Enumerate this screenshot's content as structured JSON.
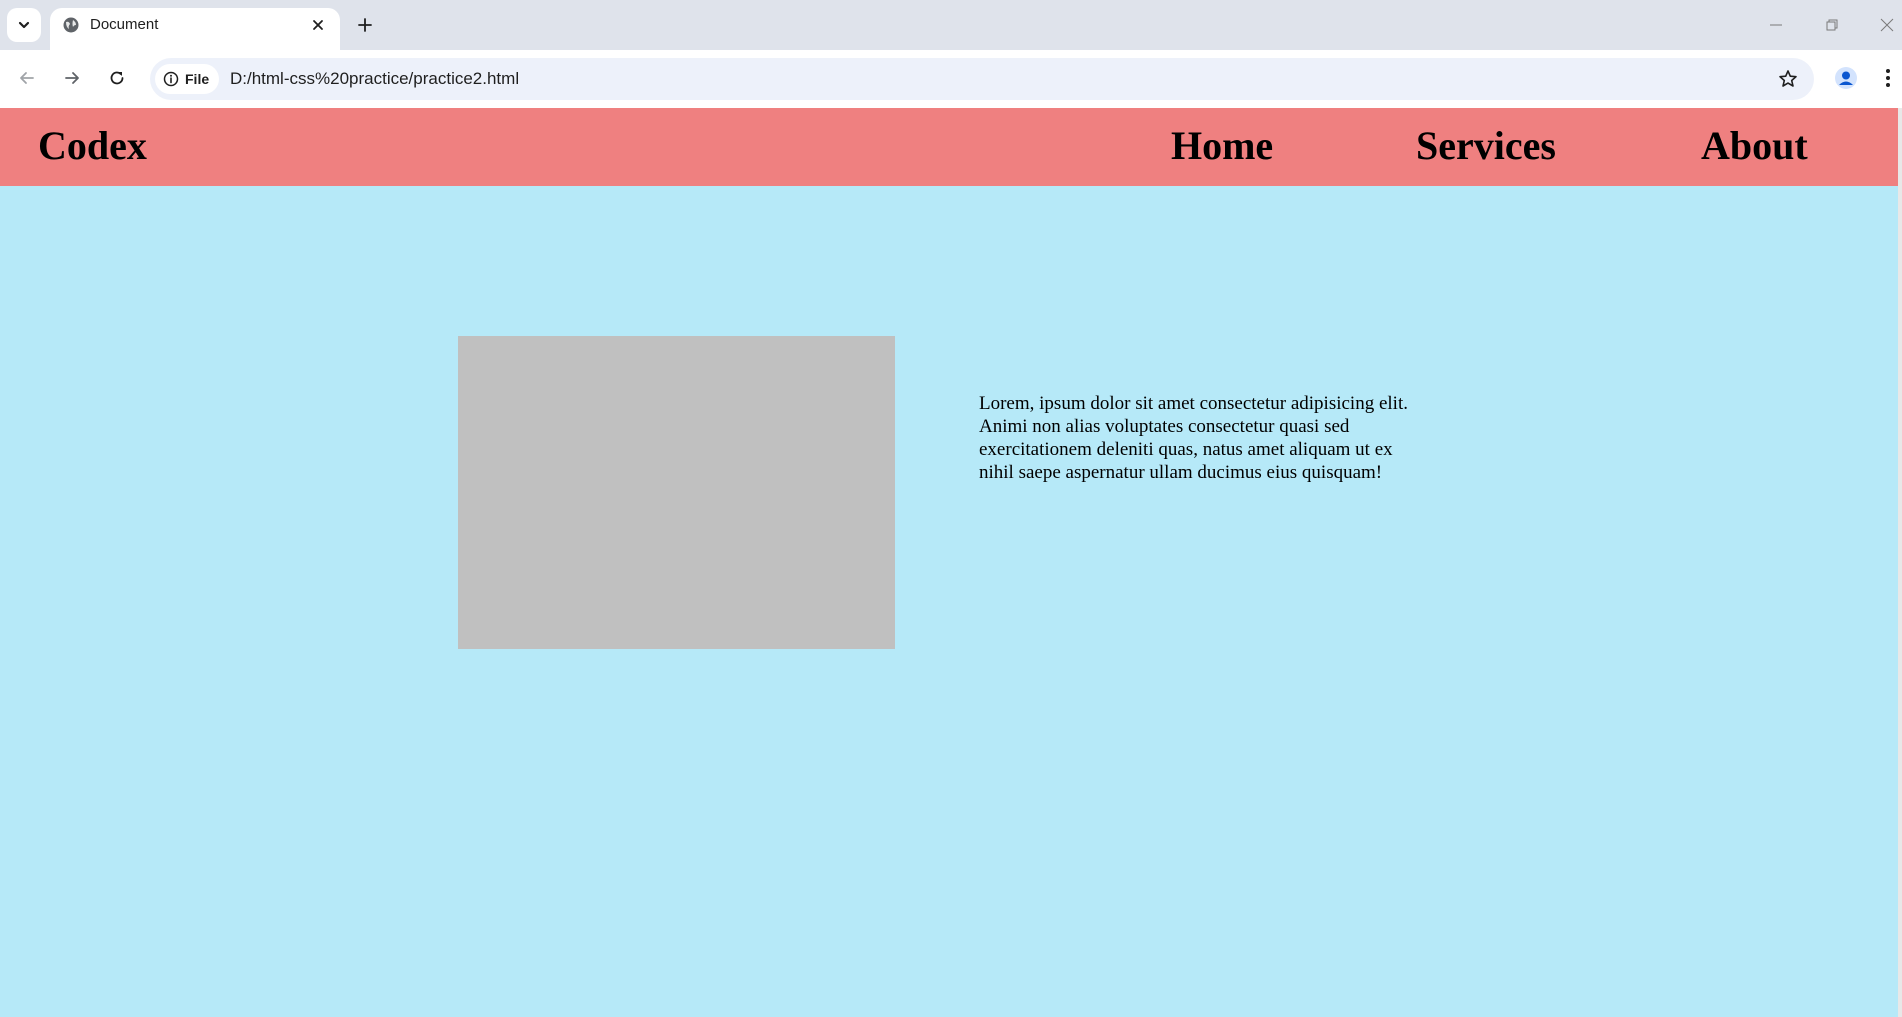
{
  "browser": {
    "tab": {
      "title": "Document",
      "favicon": "globe-icon",
      "close_icon": "close-icon"
    },
    "new_tab_icon": "plus-icon",
    "tab_search_icon": "chevron-down-icon",
    "window_controls": [
      "minimize-icon",
      "restore-icon",
      "close-icon"
    ],
    "toolbar": {
      "back_icon": "arrow-left-icon",
      "forward_icon": "arrow-right-icon",
      "reload_icon": "reload-icon",
      "site_info_label": "File",
      "url": "D:/html-css%20practice/practice2.html",
      "bookmark_icon": "star-icon",
      "profile_icon": "profile-icon",
      "menu_icon": "kebab-menu-icon"
    }
  },
  "page": {
    "background": "#b6e9f8",
    "navbar": {
      "background": "#ef8080",
      "brand": "Codex",
      "links": [
        "Home",
        "Services",
        "About"
      ]
    },
    "image_placeholder_color": "#c0c0c0",
    "paragraph": "Lorem, ipsum dolor sit amet consectetur adipisicing elit. Animi non alias voluptates consectetur quasi sed exercitationem deleniti quas, natus amet aliquam ut ex nihil saepe aspernatur ullam ducimus eius quisquam!"
  }
}
